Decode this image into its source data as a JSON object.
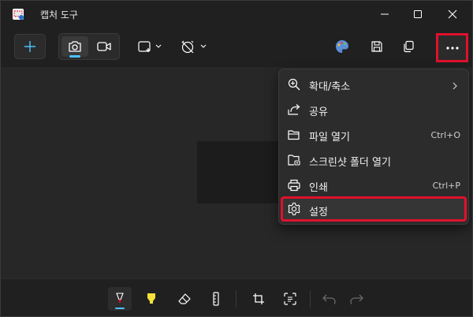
{
  "window": {
    "title": "캡처 도구",
    "app_icon": "snipping-tool-icon"
  },
  "toolbar": {
    "new_icon": "plus-icon",
    "modes": [
      {
        "name": "screenshot",
        "icon": "camera-icon",
        "selected": true
      },
      {
        "name": "video",
        "icon": "video-camera-icon",
        "selected": false
      }
    ],
    "shape_icon": "rectangle-select-icon",
    "timer_icon": "no-timer-icon",
    "right_icons": [
      "paint-icon",
      "save-icon",
      "copy-icon",
      "more-icon"
    ]
  },
  "menu": {
    "items": [
      {
        "label": "확대/축소",
        "icon": "zoom-icon",
        "shortcut": "",
        "submenu": true
      },
      {
        "label": "공유",
        "icon": "share-icon",
        "shortcut": ""
      },
      {
        "label": "파일 열기",
        "icon": "folder-open-icon",
        "shortcut": "Ctrl+O"
      },
      {
        "label": "스크린샷 폴더 열기",
        "icon": "screenshot-folder-icon",
        "shortcut": ""
      },
      {
        "label": "인쇄",
        "icon": "printer-icon",
        "shortcut": "Ctrl+P"
      },
      {
        "label": "설정",
        "icon": "gear-icon",
        "shortcut": ""
      }
    ]
  },
  "bottom_tools": [
    "ballpoint-pen-icon",
    "highlighter-icon",
    "eraser-icon",
    "ruler-icon",
    "crop-icon",
    "text-actions-icon",
    "undo-icon",
    "redo-icon"
  ],
  "colors": {
    "accent": "#4cc2ff",
    "highlight_border": "#e0112b",
    "background": "#202020",
    "canvas": "#272727",
    "menu": "#2c2c2c"
  }
}
